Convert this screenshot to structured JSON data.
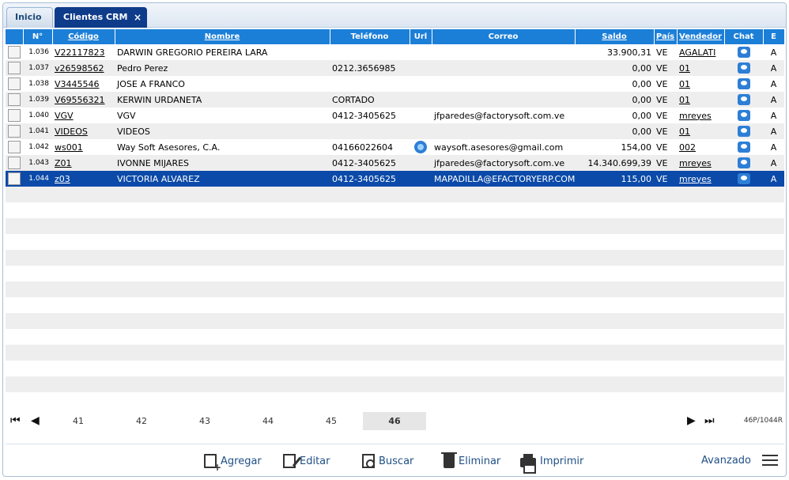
{
  "tabs": {
    "home": "Inicio",
    "active": "Clientes CRM",
    "close": "×"
  },
  "columns": [
    "N°",
    "Código",
    "Nombre",
    "Teléfono",
    "Url",
    "Correo",
    "Saldo",
    "País",
    "Vendedor",
    "Chat",
    "E"
  ],
  "rows": [
    {
      "n": "1.036",
      "codigo": "V22117823",
      "nombre": "DARWIN GREGORIO PEREIRA LARA",
      "telefono": "",
      "url": false,
      "correo": "",
      "saldo": "33.900,31",
      "pais": "VE",
      "vendedor": "AGALATI",
      "estado": "A"
    },
    {
      "n": "1.037",
      "codigo": "v26598562",
      "nombre": "Pedro Perez",
      "telefono": "0212.3656985",
      "url": false,
      "correo": "",
      "saldo": "0,00",
      "pais": "VE",
      "vendedor": "01",
      "estado": "A"
    },
    {
      "n": "1.038",
      "codigo": "V3445546",
      "nombre": "JOSE A FRANCO",
      "telefono": "",
      "url": false,
      "correo": "",
      "saldo": "0,00",
      "pais": "VE",
      "vendedor": "01",
      "estado": "A"
    },
    {
      "n": "1.039",
      "codigo": "V69556321",
      "nombre": "KERWIN URDANETA",
      "telefono": "CORTADO",
      "url": false,
      "correo": "",
      "saldo": "0,00",
      "pais": "VE",
      "vendedor": "01",
      "estado": "A"
    },
    {
      "n": "1.040",
      "codigo": "VGV",
      "nombre": "VGV",
      "telefono": "0412-3405625",
      "url": false,
      "correo": "jfparedes@factorysoft.com.ve",
      "saldo": "0,00",
      "pais": "VE",
      "vendedor": "mreyes",
      "estado": "A"
    },
    {
      "n": "1.041",
      "codigo": "VIDEOS",
      "nombre": "VIDEOS",
      "telefono": "",
      "url": false,
      "correo": "",
      "saldo": "0,00",
      "pais": "VE",
      "vendedor": "01",
      "estado": "A"
    },
    {
      "n": "1.042",
      "codigo": "ws001",
      "nombre": "Way Soft Asesores, C.A.",
      "telefono": "04166022604",
      "url": true,
      "correo": "waysoft.asesores@gmail.com",
      "saldo": "154,00",
      "pais": "VE",
      "vendedor": "002",
      "estado": "A"
    },
    {
      "n": "1.043",
      "codigo": "Z01",
      "nombre": "IVONNE MIJARES",
      "telefono": "0412-3405625",
      "url": false,
      "correo": "jfparedes@factorysoft.com.ve",
      "saldo": "14.340.699,39",
      "pais": "VE",
      "vendedor": "mreyes",
      "estado": "A"
    },
    {
      "n": "1.044",
      "codigo": "z03",
      "nombre": "VICTORIA ALVAREZ",
      "telefono": "0412-3405625",
      "url": false,
      "correo": "MAPADILLA@EFACTORYERP.COM",
      "saldo": "115,00",
      "pais": "VE",
      "vendedor": "mreyes",
      "estado": "A",
      "selected": true
    }
  ],
  "pager": {
    "pages": [
      "41",
      "42",
      "43",
      "44",
      "45",
      "46"
    ],
    "current": "46",
    "info": "46P/1044R"
  },
  "toolbar": {
    "add": "Agregar",
    "edit": "Editar",
    "search": "Buscar",
    "delete": "Eliminar",
    "print": "Imprimir",
    "advanced": "Avanzado"
  },
  "colors": {
    "header": "#1c7fd7",
    "selected": "#0b4aa8",
    "active_tab": "#0f3c8a"
  }
}
